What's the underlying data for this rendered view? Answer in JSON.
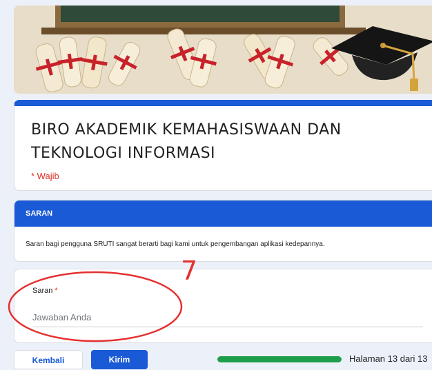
{
  "form": {
    "title": "BIRO AKADEMIK KEMAHASISWAAN DAN TEKNOLOGI INFORMASI",
    "required_note": "* Wajib"
  },
  "section": {
    "title": "SARAN",
    "description": "Saran bagi pengguna SRUTI sangat berarti bagi kami untuk pengembangan aplikasi kedepannya."
  },
  "question": {
    "label": "Saran",
    "required_marker": "*",
    "placeholder": "Jawaban Anda"
  },
  "annotation": {
    "number": "7",
    "color": "#e53030"
  },
  "navigation": {
    "back_label": "Kembali",
    "submit_label": "Kirim"
  },
  "progress": {
    "fraction": 1.0,
    "label": "Halaman 13 dari 13"
  },
  "colors": {
    "accent": "#1a5ad6",
    "required": "#d93025",
    "progress": "#1e9e4a"
  },
  "header_image": {
    "icons": [
      "diploma-scroll-icon",
      "graduation-cap-icon",
      "chalkboard-icon"
    ]
  }
}
